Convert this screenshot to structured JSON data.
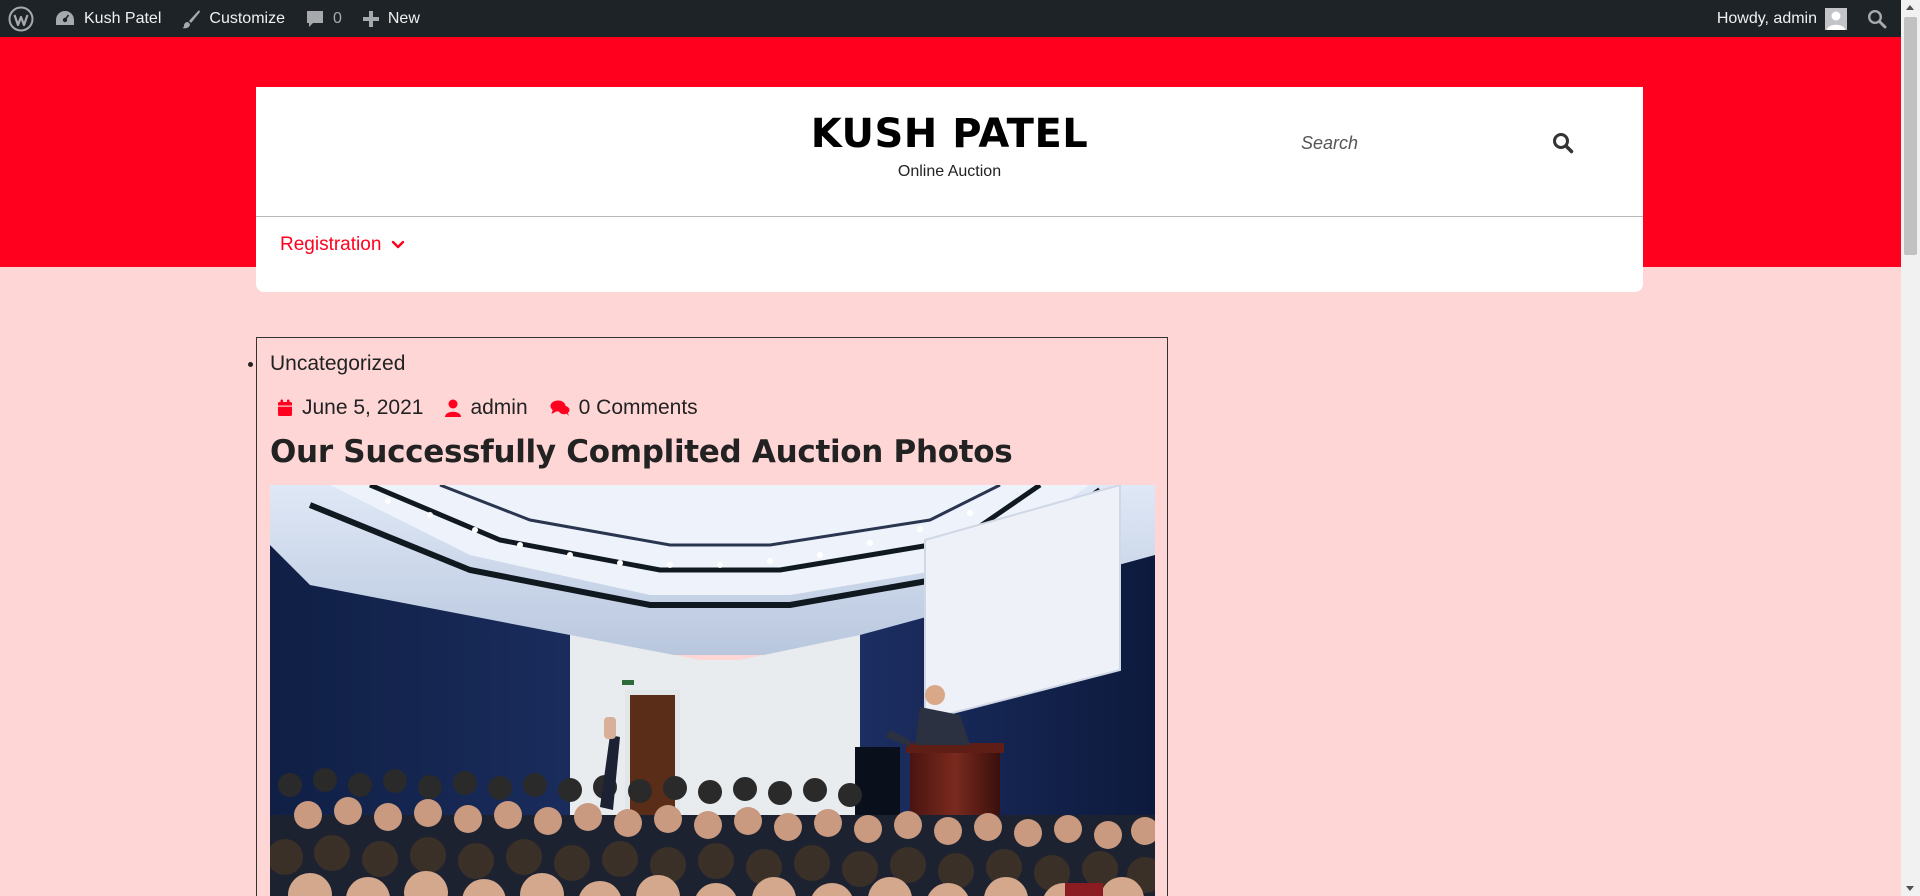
{
  "adminbar": {
    "site_name": "Kush Patel",
    "customize": "Customize",
    "comments_count": "0",
    "new_label": "New",
    "howdy": "Howdy, admin"
  },
  "site": {
    "title": "KUSH PATEL",
    "tagline": "Online Auction"
  },
  "search": {
    "placeholder": "Search"
  },
  "nav": {
    "items": [
      {
        "label": "Registration"
      }
    ]
  },
  "post": {
    "category": "Uncategorized",
    "date": "June 5, 2021",
    "author": "admin",
    "comments": "0 Comments",
    "title": "Our Successfully Complited Auction Photos"
  },
  "colors": {
    "brand_red": "#ff001e",
    "page_background": "#ffd6d6",
    "admin_bar": "#1d2327"
  }
}
